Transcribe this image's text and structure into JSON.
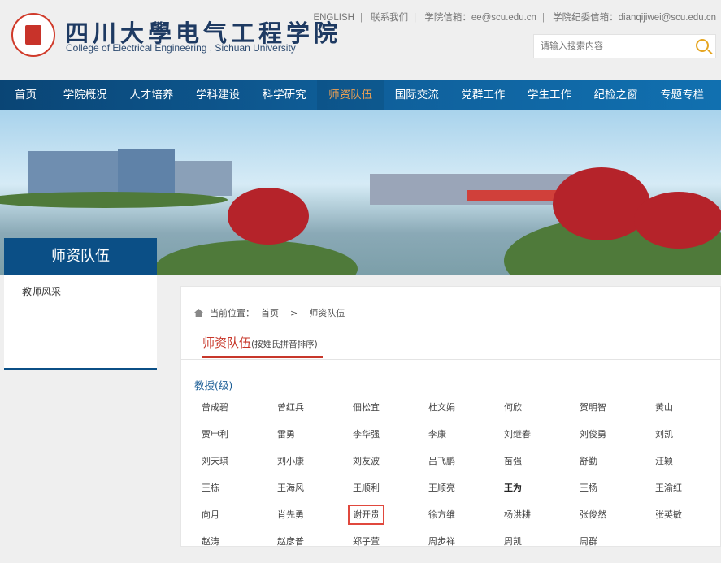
{
  "header": {
    "logo_cn": "四川大學电气工程学院",
    "logo_en": "College of Electrical Engineering , Sichuan University",
    "links": [
      "ENGLISH",
      "联系我们",
      "学院信箱：ee@scu.edu.cn",
      "学院纪委信箱：dianqijiwei@scu.edu.cn"
    ],
    "search_placeholder": "请输入搜索内容"
  },
  "nav": {
    "items": [
      "首页",
      "学院概况",
      "人才培养",
      "学科建设",
      "科学研究",
      "师资队伍",
      "国际交流",
      "党群工作",
      "学生工作",
      "纪检之窗",
      "专题专栏"
    ],
    "active": "师资队伍"
  },
  "sidebar": {
    "title": "师资队伍",
    "items": [
      "教师风采"
    ]
  },
  "breadcrumb": {
    "label": "当前位置：",
    "home": "首页",
    "sep": ">",
    "current": "师资队伍"
  },
  "tab": {
    "title": "师资队伍",
    "subtitle": "(按姓氏拼音排序)"
  },
  "category": "教授(级)",
  "people": [
    "曾成碧",
    "曾红兵",
    "佃松宜",
    "杜文娟",
    "何欣",
    "贺明智",
    "黄山",
    "贾申利",
    "雷勇",
    "李华强",
    "李康",
    "刘继春",
    "刘俊勇",
    "刘凯",
    "刘天琪",
    "刘小康",
    "刘友波",
    "吕飞鹏",
    "苗强",
    "舒勤",
    "汪颖",
    "王栋",
    "王海风",
    "王顺利",
    "王顺亮",
    "王为",
    "王杨",
    "王渝红",
    "向月",
    "肖先勇",
    "谢开贵",
    "徐方维",
    "杨洪耕",
    "张俊然",
    "张英敏",
    "赵涛",
    "赵彦普",
    "郑子萱",
    "周步祥",
    "周凯",
    "周群"
  ],
  "highlighted": "谢开贵",
  "bold": "王为",
  "colors": {
    "nav": "#0f5f9a",
    "active": "#f0a152",
    "accent": "#c7372a",
    "link": "#1c5e96"
  }
}
